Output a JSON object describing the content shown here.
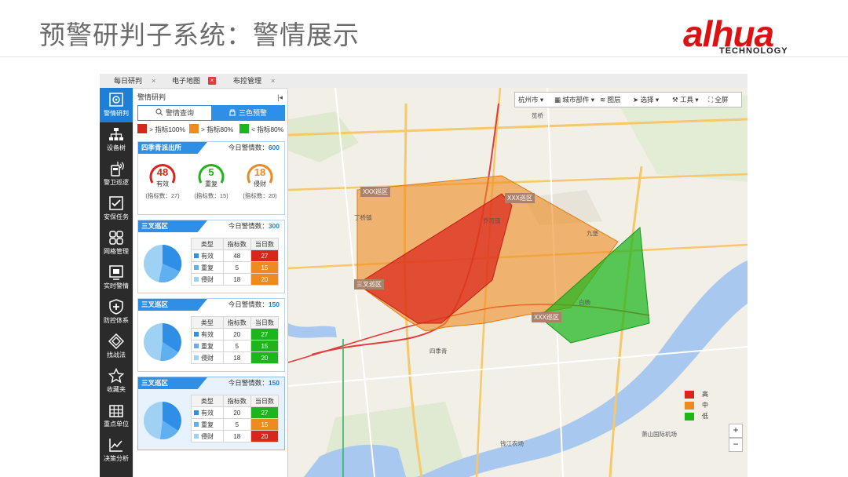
{
  "slide": {
    "title": "预警研判子系统：警情展示",
    "logo_text": "alhua",
    "logo_sub": "TECHNOLOGY"
  },
  "tabs": [
    {
      "label": "每日研判",
      "close": "×"
    },
    {
      "label": "电子地图",
      "close": "×"
    },
    {
      "label": "布控管理",
      "close": "×"
    }
  ],
  "sidebar": {
    "items": [
      {
        "label": "警情研判",
        "icon": "target-icon",
        "active": true
      },
      {
        "label": "设备树",
        "icon": "tree-icon"
      },
      {
        "label": "警卫巡逻",
        "icon": "radio-icon"
      },
      {
        "label": "安保任务",
        "icon": "checklist-icon"
      },
      {
        "label": "网格管理",
        "icon": "grid-icon"
      },
      {
        "label": "实时警情",
        "icon": "monitor-icon"
      },
      {
        "label": "防控体系",
        "icon": "shield-plus-icon"
      },
      {
        "label": "找战法",
        "icon": "diamond-icon"
      },
      {
        "label": "收藏夹",
        "icon": "star-icon"
      },
      {
        "label": "重点单位",
        "icon": "building-icon"
      },
      {
        "label": "决策分析",
        "icon": "chart-line-icon"
      }
    ]
  },
  "panel": {
    "title": "警情研判",
    "pin": "|◂",
    "seg_query": "警情查询",
    "seg_warning": "三色预警",
    "legend": [
      {
        "label": "> 指标100%",
        "color": "#d9261c"
      },
      {
        "label": "> 指标80%",
        "color": "#ef8a1f"
      },
      {
        "label": "< 指标80%",
        "color": "#1cb51c"
      }
    ],
    "summary": {
      "title": "四季青派出所",
      "count_label": "今日警情数：",
      "count": "600",
      "gauges": [
        {
          "value": "48",
          "name": "有效",
          "sub": "(指标数：27)",
          "color": "#d9261c"
        },
        {
          "value": "5",
          "name": "重复",
          "sub": "(指标数：15)",
          "color": "#1cb51c"
        },
        {
          "value": "18",
          "name": "侵财",
          "sub": "(指标数：20)",
          "color": "#ef8a1f"
        }
      ]
    },
    "table_headers": [
      "类型",
      "指标数",
      "当日数"
    ],
    "cards": [
      {
        "title": "三叉巡区",
        "count_label": "今日警情数：",
        "count": "300",
        "rows": [
          {
            "type": "有效",
            "target": "48",
            "today": "27",
            "color": "#d9261c"
          },
          {
            "type": "重复",
            "target": "5",
            "today": "15",
            "color": "#ef8a1f"
          },
          {
            "type": "侵财",
            "target": "18",
            "today": "20",
            "color": "#ef8a1f"
          }
        ]
      },
      {
        "title": "三叉巡区",
        "count_label": "今日警情数：",
        "count": "150",
        "rows": [
          {
            "type": "有效",
            "target": "20",
            "today": "27",
            "color": "#1cb51c"
          },
          {
            "type": "重复",
            "target": "5",
            "today": "15",
            "color": "#1cb51c"
          },
          {
            "type": "侵财",
            "target": "18",
            "today": "20",
            "color": "#1cb51c"
          }
        ]
      },
      {
        "title": "三叉巡区",
        "count_label": "今日警情数：",
        "count": "150",
        "rows": [
          {
            "type": "有效",
            "target": "20",
            "today": "27",
            "color": "#1cb51c"
          },
          {
            "type": "重复",
            "target": "5",
            "today": "15",
            "color": "#ef8a1f"
          },
          {
            "type": "侵财",
            "target": "18",
            "today": "20",
            "color": "#d9261c"
          }
        ]
      }
    ]
  },
  "map": {
    "toolbar": {
      "city": "杭州市",
      "city_parts": "城市部件",
      "layers": "图层",
      "select": "选择",
      "tools": "工具",
      "fullscreen": "全屏"
    },
    "zoom_in": "+",
    "zoom_out": "−",
    "legend": [
      {
        "label": "高",
        "color": "#d9261c"
      },
      {
        "label": "中",
        "color": "#ef8a1f"
      },
      {
        "label": "低",
        "color": "#1cb51c"
      }
    ],
    "area_badges": [
      "XXX巡区",
      "XXX巡区",
      "三叉巡区",
      "XXX巡区"
    ],
    "place_labels": [
      "丁桥镇",
      "乔司镇",
      "四季青",
      "白杨",
      "九堡",
      "钱江农场",
      "笕桥",
      "萧山国际机场"
    ]
  }
}
